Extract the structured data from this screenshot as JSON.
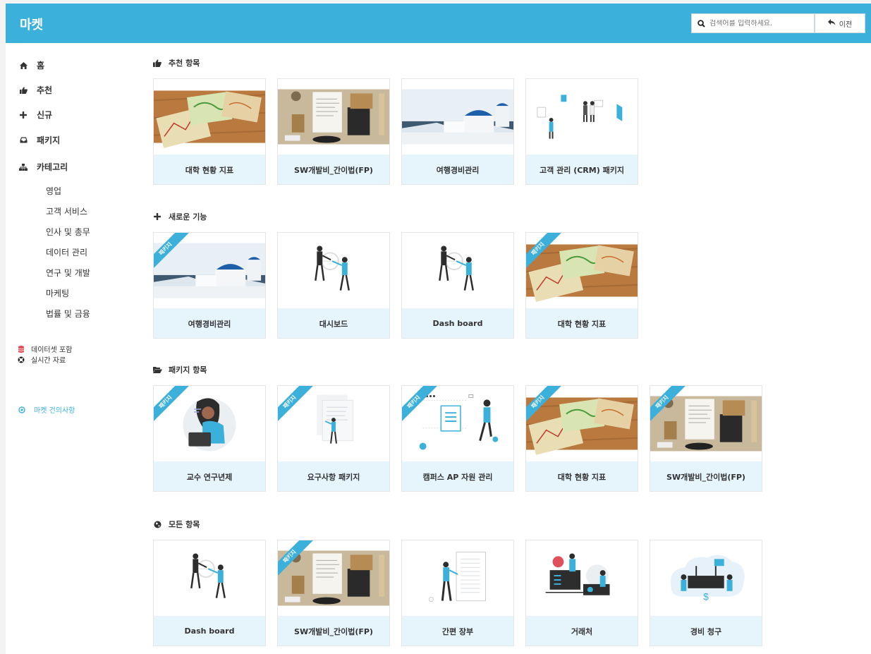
{
  "header": {
    "title": "마켓",
    "search_placeholder": "검색어를 입력하세요.",
    "back_label": "이전"
  },
  "sidebar": {
    "items": [
      {
        "label": "홈",
        "icon": "home-icon"
      },
      {
        "label": "추천",
        "icon": "thumbs-up-icon"
      },
      {
        "label": "신규",
        "icon": "plus-icon"
      },
      {
        "label": "패키지",
        "icon": "inbox-icon"
      },
      {
        "label": "카테고리",
        "icon": "sitemap-icon"
      }
    ],
    "categories": [
      "영업",
      "고객 서비스",
      "인사 및 총무",
      "데이터 관리",
      "연구 및 개발",
      "마케팅",
      "법률 및 금융"
    ],
    "extras": [
      {
        "label": "데이터셋 포함",
        "icon": "database-icon"
      },
      {
        "label": "실시간 자료",
        "icon": "life-ring-icon"
      }
    ],
    "feedback_label": "마켓 건의사항"
  },
  "sections": {
    "recommended": {
      "title": "추천 항목",
      "cards": [
        {
          "label": "대학 현황 지표",
          "image": "maps-photo"
        },
        {
          "label": "SW개발비_간이법(FP)",
          "image": "stationery-photo"
        },
        {
          "label": "여행경비관리",
          "image": "santorini-photo"
        },
        {
          "label": "고객 관리 (CRM) 패키지",
          "image": "crm-illustration"
        }
      ]
    },
    "new": {
      "title": "새로운 기능",
      "cards": [
        {
          "label": "여행경비관리",
          "image": "santorini-photo",
          "ribbon": "패키지"
        },
        {
          "label": "대시보드",
          "image": "dashboard-illustration"
        },
        {
          "label": "Dash board",
          "image": "dashboard-illustration"
        },
        {
          "label": "대학 현황 지표",
          "image": "maps-photo",
          "ribbon": "패키지"
        }
      ]
    },
    "packages": {
      "title": "패키지 항목",
      "cards": [
        {
          "label": "교수 연구년제",
          "image": "professor-illustration",
          "ribbon": "패키지"
        },
        {
          "label": "요구사항 패키지",
          "image": "requirements-illustration",
          "ribbon": "패키지"
        },
        {
          "label": "캠퍼스 AP 자원 관리",
          "image": "campus-illustration",
          "ribbon": "패키지"
        },
        {
          "label": "대학 현황 지표",
          "image": "maps-photo",
          "ribbon": "패키지"
        },
        {
          "label": "SW개발비_간이법(FP)",
          "image": "stationery-photo",
          "ribbon": "패키지"
        }
      ]
    },
    "all": {
      "title": "모든 항목",
      "cards": [
        {
          "label": "Dash board",
          "image": "dashboard-illustration"
        },
        {
          "label": "SW개발비_간이법(FP)",
          "image": "stationery-photo",
          "ribbon": "패키지"
        },
        {
          "label": "간편 장부",
          "image": "ledger-illustration"
        },
        {
          "label": "거래처",
          "image": "client-illustration"
        },
        {
          "label": "경비 청구",
          "image": "expense-illustration"
        }
      ]
    }
  }
}
